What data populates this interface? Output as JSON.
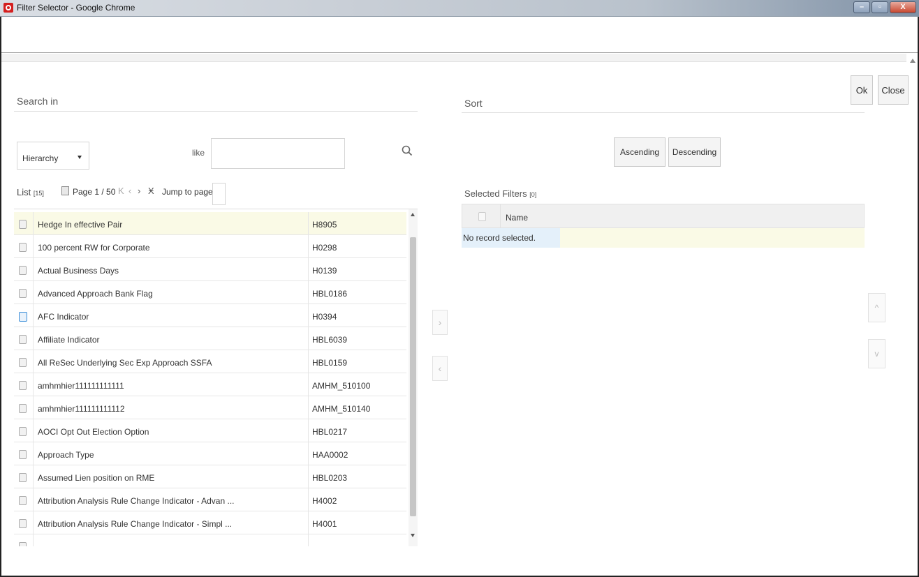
{
  "window": {
    "title": "Filter Selector - Google Chrome",
    "controls": [
      "minimize",
      "maximize",
      "close"
    ]
  },
  "actions": {
    "ok_label": "Ok",
    "close_label": "Close"
  },
  "search": {
    "title": "Search in",
    "hierarchy_select": "Hierarchy",
    "like_label": "like",
    "like_value": ""
  },
  "list": {
    "label": "List",
    "count": "[15]",
    "page_text": "Page 1 / 50",
    "nav_first": "K",
    "nav_prev": "‹",
    "nav_next": "›",
    "nav_last": "Ӿ",
    "jump_label": "Jump to page",
    "jump_value": "",
    "rows": [
      {
        "name": "Hedge In effective Pair",
        "code": "H8905"
      },
      {
        "name": "100 percent RW for Corporate",
        "code": "H0298"
      },
      {
        "name": "Actual Business Days",
        "code": "H0139"
      },
      {
        "name": "Advanced Approach Bank Flag",
        "code": "HBL0186"
      },
      {
        "name": "AFC Indicator",
        "code": "H0394"
      },
      {
        "name": "Affiliate Indicator",
        "code": "HBL6039"
      },
      {
        "name": "All ReSec Underlying Sec Exp Approach SSFA",
        "code": "HBL0159"
      },
      {
        "name": "amhmhier111111111111",
        "code": "AMHM_510100"
      },
      {
        "name": "amhmhier111111111112",
        "code": "AMHM_510140"
      },
      {
        "name": "AOCI Opt Out Election Option",
        "code": "HBL0217"
      },
      {
        "name": "Approach Type",
        "code": "HAA0002"
      },
      {
        "name": "Assumed Lien position on RME",
        "code": "HBL0203"
      },
      {
        "name": "Attribution Analysis Rule Change Indicator - Advan ...",
        "code": "H4002"
      },
      {
        "name": "Attribution Analysis Rule Change Indicator - Simpl ...",
        "code": "H4001"
      }
    ]
  },
  "move": {
    "right": "›",
    "left": "‹"
  },
  "sort": {
    "title": "Sort",
    "ascending_label": "Ascending",
    "descending_label": "Descending"
  },
  "selected": {
    "title": "Selected Filters",
    "count": "[0]",
    "column_name": "Name",
    "empty_message": "No record selected."
  },
  "order": {
    "up": "^",
    "down": "v"
  }
}
